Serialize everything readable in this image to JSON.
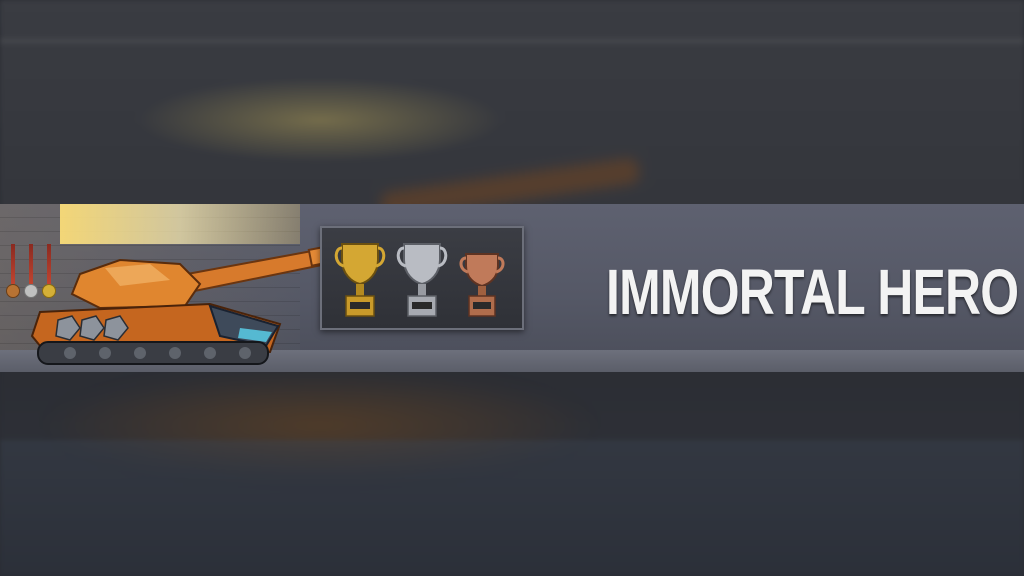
{
  "banner": {
    "title": "IMMORTAL HERO"
  },
  "medals": [
    {
      "name": "bronze",
      "color": "#b87333"
    },
    {
      "name": "silver",
      "color": "#c0c0c0"
    },
    {
      "name": "gold",
      "color": "#d4af37"
    }
  ],
  "trophies": [
    {
      "name": "gold",
      "color": "#d4a733"
    },
    {
      "name": "silver",
      "color": "#b9bcc3"
    },
    {
      "name": "bronze",
      "color": "#c07a5a"
    }
  ],
  "tank": {
    "icon": "tank-icon",
    "primary_color": "#d9792a"
  },
  "colors": {
    "banner": "#555866",
    "title": "#f3f3f3",
    "backdrop": "#2a2c33"
  }
}
